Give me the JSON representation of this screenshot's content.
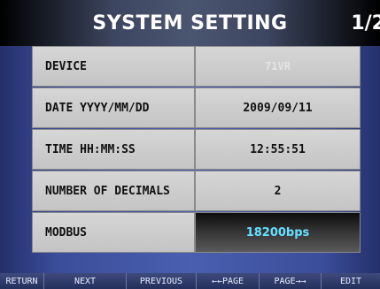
{
  "header": {
    "title": "SYSTEM SETTING",
    "page": "1/2"
  },
  "settings": [
    {
      "label": "DEVICE",
      "value": "71VR"
    },
    {
      "label": "DATE YYYY/MM/DD",
      "value": "2009/09/11"
    },
    {
      "label": "TIME HH:MM:SS",
      "value": "12:55:51"
    },
    {
      "label": "NUMBER OF DECIMALS",
      "value": "2"
    },
    {
      "label": "MODBUS",
      "value": "18200bps"
    }
  ],
  "toolbar": {
    "return": "RETURN",
    "next": "NEXT",
    "previous": "PREVIOUS",
    "page_back": "←←PAGE",
    "page_fwd": "PAGE→→",
    "edit": "EDIT"
  },
  "colors": {
    "modbus_value": "#66e0ff",
    "cell_bg": "#cfcfcf",
    "background": "#4a5fb0"
  }
}
